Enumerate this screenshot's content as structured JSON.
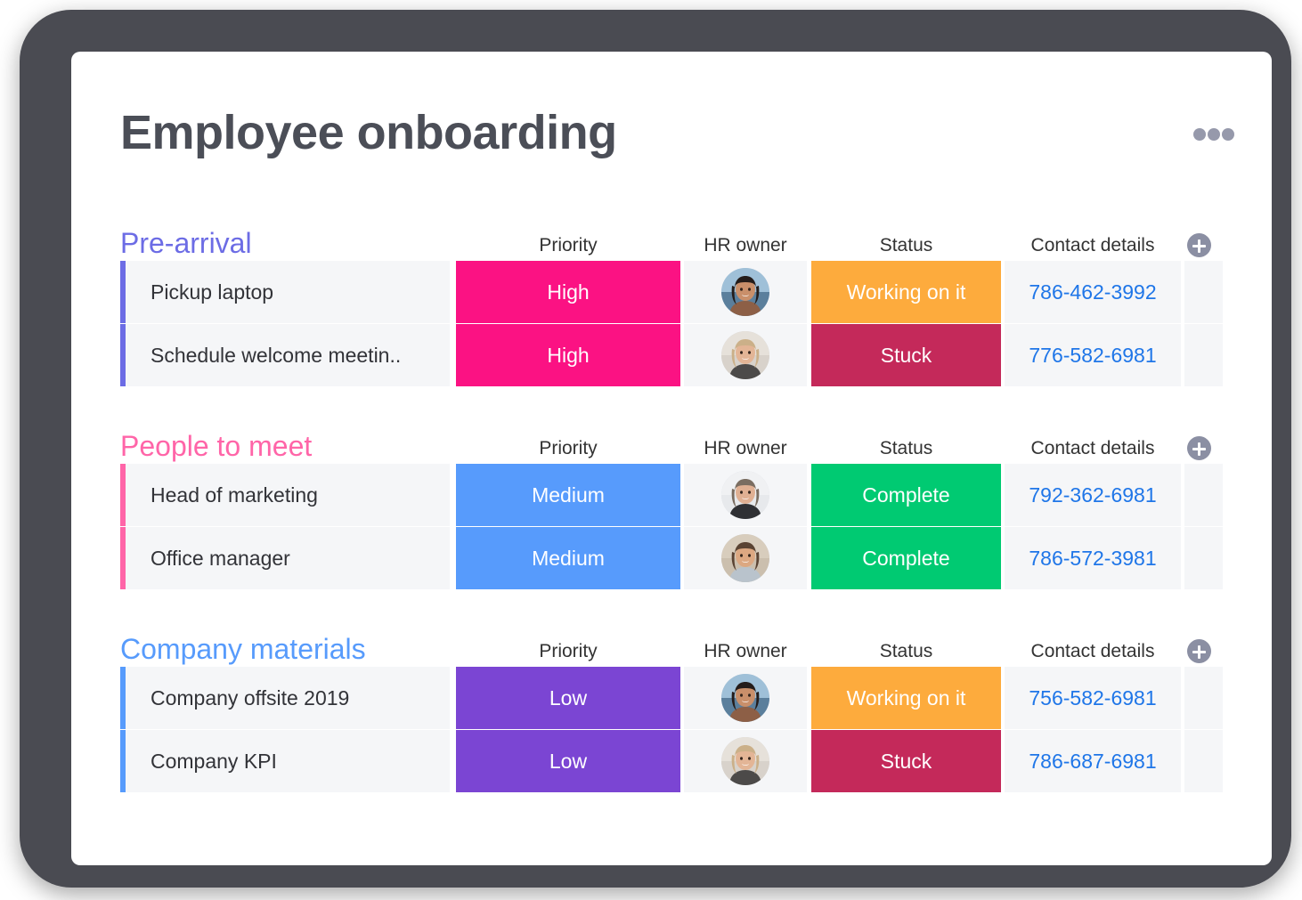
{
  "board": {
    "title": "Employee onboarding",
    "more_menu_label": "More options"
  },
  "columns": {
    "priority": "Priority",
    "owner": "HR owner",
    "status": "Status",
    "contact": "Contact details",
    "add_column": "+"
  },
  "colors": {
    "group_pre_arrival": "#6c6ce5",
    "group_people_to_meet": "#ff65a8",
    "group_company_materials": "#579bfc",
    "priority_high": "#fb1283",
    "priority_medium": "#579bfc",
    "priority_low": "#7b45d3",
    "status_working": "#fdab3d",
    "status_stuck": "#c4295a",
    "status_complete": "#00ca72",
    "row_background": "#f5f6f8",
    "link_blue": "#1f76e8",
    "title_gray": "#4b4e57"
  },
  "groups": [
    {
      "name": "Pre-arrival",
      "accent": "#6c6ce5",
      "rows": [
        {
          "name": "Pickup laptop",
          "priority": "High",
          "priority_color": "#fb1283",
          "owner": "owner-avatar-beach",
          "status": "Working on it",
          "status_color": "#fdab3d",
          "contact": "786-462-3992"
        },
        {
          "name": "Schedule welcome meetin..",
          "priority": "High",
          "priority_color": "#fb1283",
          "owner": "owner-avatar-blonde",
          "status": "Stuck",
          "status_color": "#c4295a",
          "contact": "776-582-6981"
        }
      ]
    },
    {
      "name": "People to meet",
      "accent": "#ff65a8",
      "rows": [
        {
          "name": "Head of marketing",
          "priority": "Medium",
          "priority_color": "#579bfc",
          "owner": "owner-avatar-longhair",
          "status": "Complete",
          "status_color": "#00ca72",
          "contact": "792-362-6981"
        },
        {
          "name": "Office manager",
          "priority": "Medium",
          "priority_color": "#579bfc",
          "owner": "owner-avatar-bun",
          "status": "Complete",
          "status_color": "#00ca72",
          "contact": "786-572-3981"
        }
      ]
    },
    {
      "name": "Company materials",
      "accent": "#579bfc",
      "rows": [
        {
          "name": "Company offsite 2019",
          "priority": "Low",
          "priority_color": "#7b45d3",
          "owner": "owner-avatar-beach",
          "status": "Working on it",
          "status_color": "#fdab3d",
          "contact": "756-582-6981"
        },
        {
          "name": "Company KPI",
          "priority": "Low",
          "priority_color": "#7b45d3",
          "owner": "owner-avatar-blonde",
          "status": "Stuck",
          "status_color": "#c4295a",
          "contact": "786-687-6981"
        }
      ]
    }
  ]
}
